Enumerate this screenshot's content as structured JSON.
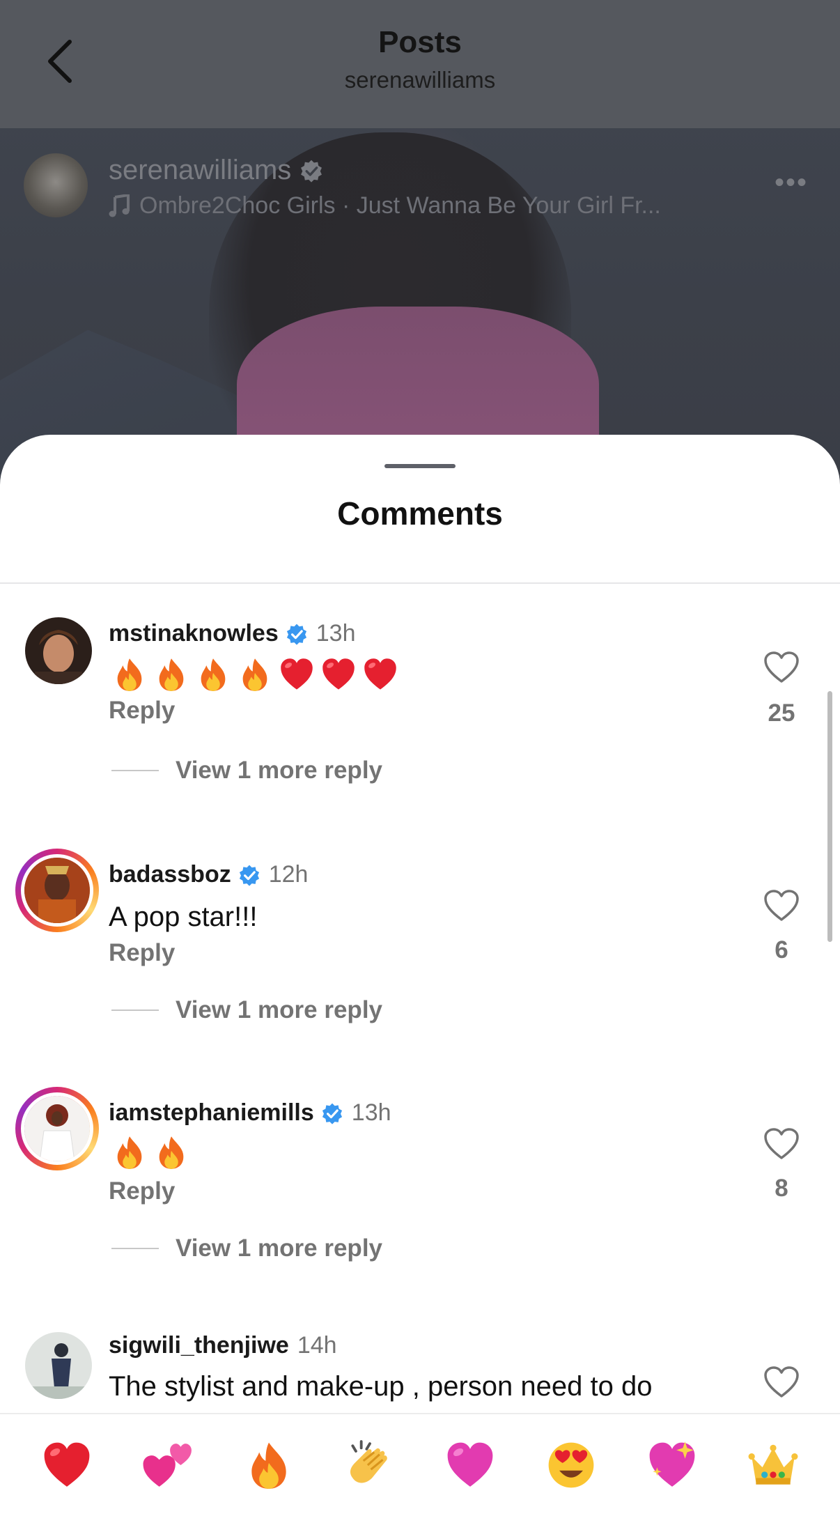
{
  "nav": {
    "title": "Posts",
    "subtitle": "serenawilliams"
  },
  "post": {
    "username": "serenawilliams",
    "verified": true,
    "music": "Ombre2Choc Girls · Just Wanna Be Your Girl Fr..."
  },
  "sheet": {
    "title": "Comments"
  },
  "comments": [
    {
      "username": "mstinaknowles",
      "verified": true,
      "time": "13h",
      "text": "",
      "emojis": [
        "fire",
        "fire",
        "fire",
        "fire",
        "heart",
        "heart",
        "heart"
      ],
      "reply_label": "Reply",
      "likes": "25",
      "view_more": "View 1 more reply",
      "story_ring": false
    },
    {
      "username": "badassboz",
      "verified": true,
      "time": "12h",
      "text": "A pop star!!!",
      "emojis": [],
      "reply_label": "Reply",
      "likes": "6",
      "view_more": "View 1 more reply",
      "story_ring": true
    },
    {
      "username": "iamstephaniemills",
      "verified": true,
      "time": "13h",
      "text": "",
      "emojis": [
        "fire",
        "fire"
      ],
      "reply_label": "Reply",
      "likes": "8",
      "view_more": "View 1 more reply",
      "story_ring": true
    },
    {
      "username": "sigwili_thenjiwe",
      "verified": false,
      "time": "14h",
      "text": "The stylist and make-up , person need to do",
      "emojis": [],
      "reply_label": "",
      "likes": "",
      "view_more": "",
      "story_ring": false
    }
  ],
  "reactions": [
    "red-heart",
    "two-hearts",
    "fire",
    "clapping-hands",
    "pink-heart",
    "heart-eyes",
    "sparkling-heart",
    "crown"
  ],
  "colors": {
    "verified_blue": "#3897f0",
    "muted_text": "#737373",
    "heart_red": "#e5202f",
    "fire_orange": "#f5821f"
  }
}
